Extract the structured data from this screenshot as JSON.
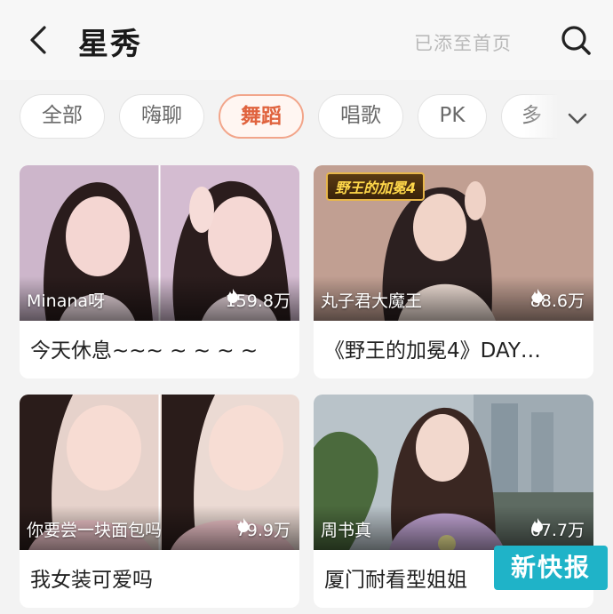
{
  "header": {
    "title": "星秀",
    "added_label": "已添至首页"
  },
  "tabs": [
    {
      "label": "全部",
      "active": false
    },
    {
      "label": "嗨聊",
      "active": false
    },
    {
      "label": "舞蹈",
      "active": true
    },
    {
      "label": "唱歌",
      "active": false
    },
    {
      "label": "PK",
      "active": false
    },
    {
      "label": "多",
      "active": false
    }
  ],
  "cards": [
    {
      "streamer": "Minana呀",
      "viewers": "159.8万",
      "caption": "今天休息~~~ ~ ~ ~ ~"
    },
    {
      "streamer": "丸子君大魔王",
      "viewers": "88.6万",
      "caption": "《野王的加冕4》DAY…",
      "badge": "野王的加冕4"
    },
    {
      "streamer": "你要尝一块面包吗",
      "viewers": "79.9万",
      "caption": "我女装可爱吗"
    },
    {
      "streamer": "周书真",
      "viewers": "67.7万",
      "caption": "厦门耐看型姐姐"
    }
  ],
  "watermark": "新快报",
  "colors": {
    "accent": "#e0633e",
    "accent_border": "#f2a58a",
    "watermark_bg": "#1fb3c8"
  },
  "icons": {
    "back": "chevron-left-icon",
    "search": "search-icon",
    "more": "chevron-down-icon",
    "viewers": "flame-icon"
  }
}
